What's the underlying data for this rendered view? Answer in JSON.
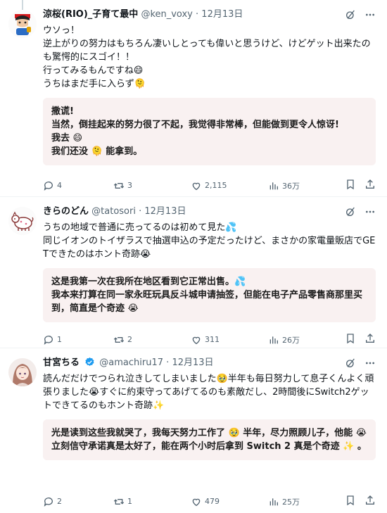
{
  "tweets": [
    {
      "name": "涼桜(RIO)_子育て最中",
      "handle": "@ken_voxy",
      "dot": "·",
      "date": "12月13日",
      "verified": false,
      "original": "ウソっ！\n逆上がりの努力はもちろん凄いしとっても偉いと思うけど、けどゲット出来たのも驚愕的にスゴイ！！\n行ってみるもんですね😄\nうちはまだ手に入らず🫠",
      "translation": "撒谎!\n当然，倒挂起来的努力很了不起，我觉得非常棒，但能做到更令人惊讶!\n我去 😄\n我们还没 🫠 能拿到。",
      "replies": "4",
      "retweets": "3",
      "likes": "2,115",
      "views": "36万"
    },
    {
      "name": "きらのどん",
      "handle": "@tatosori",
      "dot": "·",
      "date": "12月13日",
      "verified": false,
      "original": "うちの地域で普通に売ってるのは初めて見た💦\n同じイオンのトイザラスで抽選申込の予定だったけど、まさかの家電量販店でGETできたのはホント奇跡😭",
      "translation": "这是我第一次在我所在地区看到它正常出售。💦\n我本来打算在同一家永旺玩具反斗城申请抽签，但能在电子产品零售商那里买到，简直是个奇迹 😭",
      "replies": "1",
      "retweets": "2",
      "likes": "311",
      "views": "26万"
    },
    {
      "name": "甘宮ちる",
      "handle": "@amachiru17",
      "dot": "·",
      "date": "12月13日",
      "verified": true,
      "original": "読んだだけでつられ泣きしてしまいました🥹半年も毎日努力して息子くんよく頑張りました😭すぐに約束守ってあげてるのも素敵だし、2時間後にSwitch2ゲットできてるのもホント奇跡✨",
      "translation": "光是读到这些我就哭了，我每天努力工作了 🥹 半年，尽力照顾儿子，他能 😭 立刻信守承诺真是太好了，能在两个小时后拿到 Switch 2 真是个奇迹 ✨ 。",
      "replies": "2",
      "retweets": "1",
      "likes": "479",
      "views": "25万"
    }
  ],
  "icons": {
    "grok": "grok-icon",
    "more": "more-options-icon",
    "reply": "reply-icon",
    "retweet": "retweet-icon",
    "like": "like-icon",
    "views": "views-icon",
    "bookmark": "bookmark-icon",
    "share": "share-icon",
    "verified": "verified-badge-icon"
  },
  "colors": {
    "text": "#0f1419",
    "secondary": "#536471",
    "translation_bg": "#f9f1f1",
    "verified": "#1d9bf0",
    "divider": "#eff3f4"
  }
}
